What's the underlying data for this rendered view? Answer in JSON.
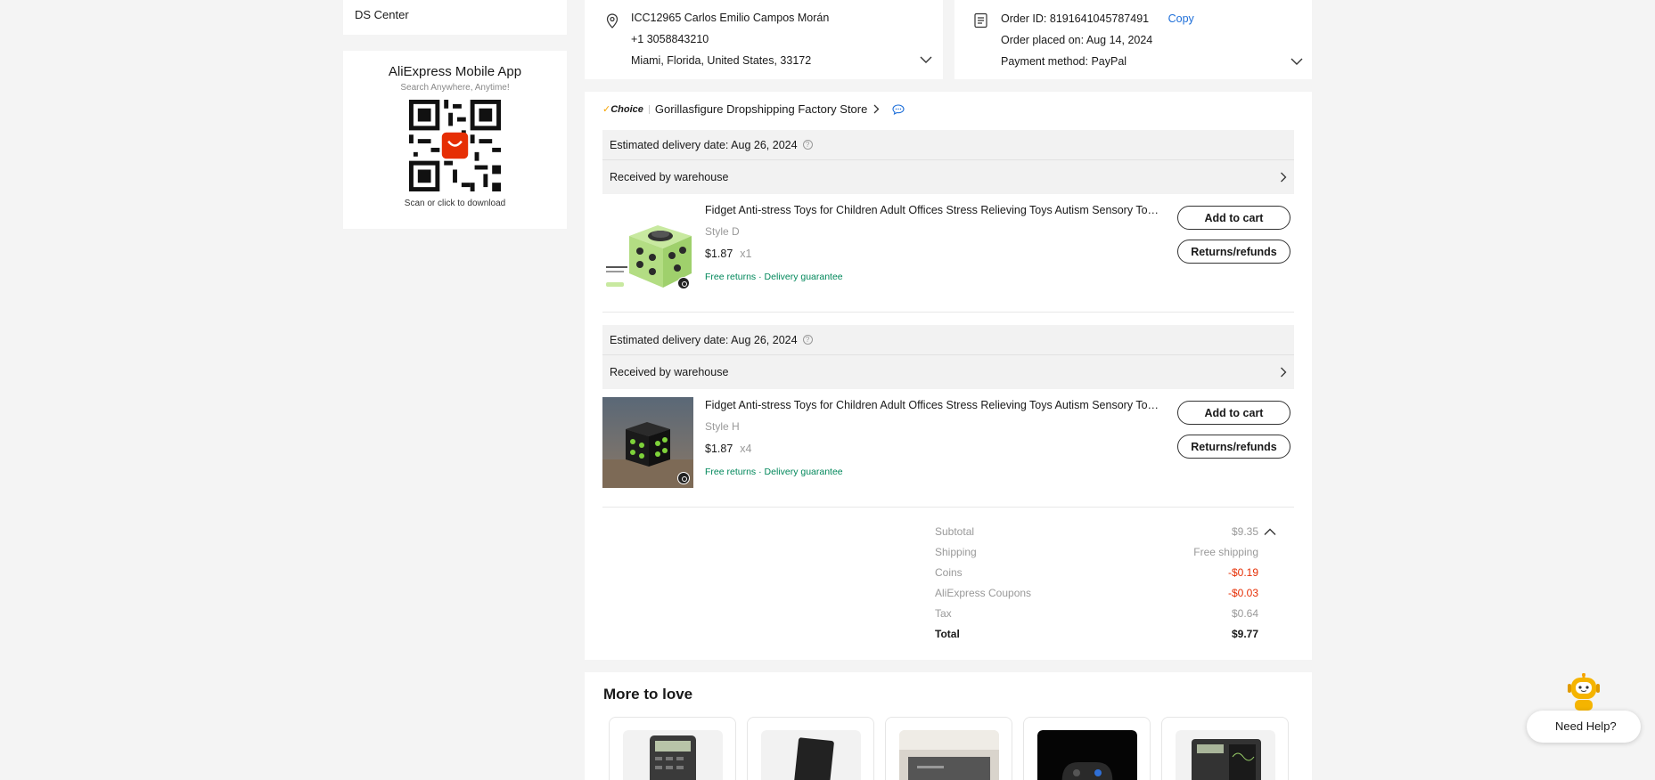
{
  "sidebar": {
    "ds_center": "DS Center",
    "app": {
      "title": "AliExpress Mobile App",
      "subtitle": "Search Anywhere, Anytime!",
      "cta": "Scan or click to download",
      "qr_badge": "AliExpress"
    }
  },
  "address": {
    "name_line": "ICC12965 Carlos Emilio Campos Morán",
    "phone": "+1 3058843210",
    "location": "Miami, Florida, United States, 33172"
  },
  "order": {
    "id_line": "Order ID: 8191641045787491",
    "copy_label": "Copy",
    "placed_line": "Order placed on: Aug 14, 2024",
    "payment_line": "Payment method: PayPal"
  },
  "store": {
    "badge": "Choice",
    "name": "Gorillasfigure Dropshipping Factory Store"
  },
  "shipments": [
    {
      "delivery": "Estimated delivery date: Aug 26, 2024",
      "status": "Received by warehouse",
      "item": {
        "title": "Fidget Anti-stress Toys for Children Adult Offices Stress Relieving Toys Autism Sensory Toys Fidget Cube",
        "style": "Style D",
        "price": "$1.87",
        "qty": "x1",
        "tags": "Free returns · Delivery guarantee",
        "color": "light-green"
      },
      "add_to_cart": "Add to cart",
      "returns": "Returns/refunds"
    },
    {
      "delivery": "Estimated delivery date: Aug 26, 2024",
      "status": "Received by warehouse",
      "item": {
        "title": "Fidget Anti-stress Toys for Children Adult Offices Stress Relieving Toys Autism Sensory Toys Fidget Cube",
        "style": "Style H",
        "price": "$1.87",
        "qty": "x4",
        "tags": "Free returns · Delivery guarantee",
        "color": "black-green"
      },
      "add_to_cart": "Add to cart",
      "returns": "Returns/refunds"
    }
  ],
  "summary": [
    {
      "key": "Subtotal",
      "value": "$9.35"
    },
    {
      "key": "Shipping",
      "value": "Free shipping"
    },
    {
      "key": "Coins",
      "value": "-$0.19"
    },
    {
      "key": "AliExpress Coupons",
      "value": "-$0.03"
    },
    {
      "key": "Tax",
      "value": "$0.64"
    },
    {
      "key": "Total",
      "value": "$9.77"
    }
  ],
  "colors": {
    "accent_blue": "#1e6fd9",
    "discount_red": "#e62e04",
    "tag_green": "#00875a",
    "choice_yellow": "#f5a300"
  },
  "more_to_love": {
    "title": "More to love",
    "products": [
      {
        "icon": "calculator-image"
      },
      {
        "icon": "black-tablet-image"
      },
      {
        "icon": "desk-mat-image"
      },
      {
        "icon": "gamepad-image"
      },
      {
        "icon": "lcd-writing-calculator-image"
      }
    ]
  },
  "help": {
    "label": "Need Help?"
  }
}
